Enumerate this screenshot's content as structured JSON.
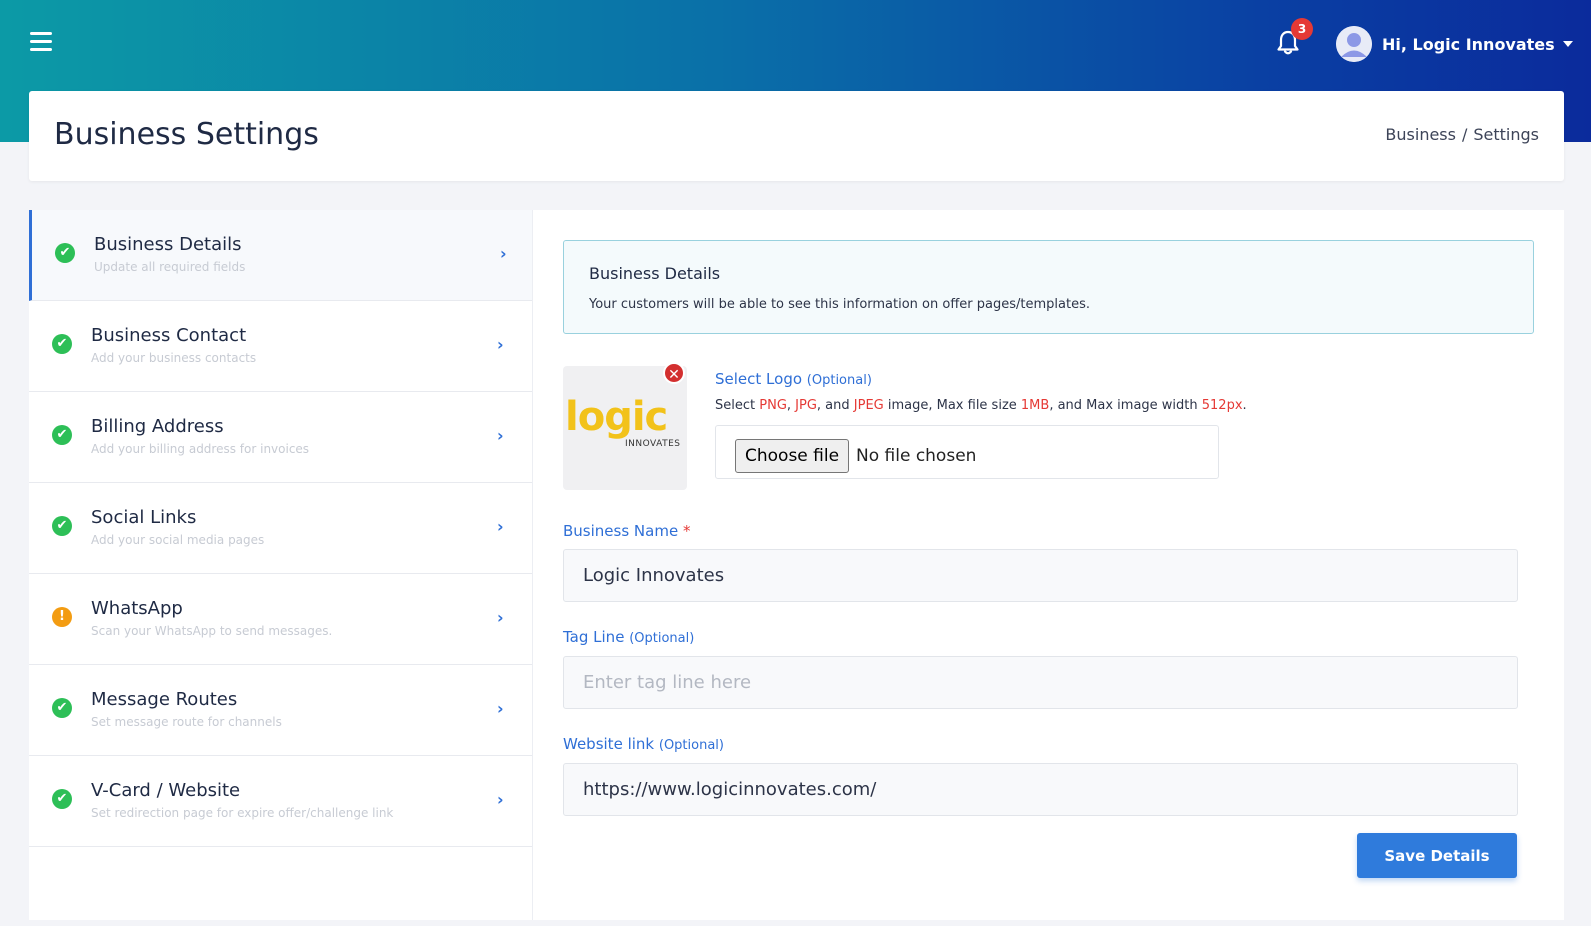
{
  "topbar": {
    "notification_count": "3",
    "user_greeting": "Hi, Logic Innovates"
  },
  "header": {
    "title": "Business Settings",
    "breadcrumb": [
      "Business",
      "Settings"
    ],
    "breadcrumb_sep": "/"
  },
  "sidebar": {
    "items": [
      {
        "title": "Business Details",
        "subtitle": "Update all required fields",
        "status": "ok",
        "status_glyph": "✔",
        "chevron": "›"
      },
      {
        "title": "Business Contact",
        "subtitle": "Add your business contacts",
        "status": "ok",
        "status_glyph": "✔",
        "chevron": "›"
      },
      {
        "title": "Billing Address",
        "subtitle": "Add your billing address for invoices",
        "status": "ok",
        "status_glyph": "✔",
        "chevron": "›"
      },
      {
        "title": "Social Links",
        "subtitle": "Add your social media pages",
        "status": "ok",
        "status_glyph": "✔",
        "chevron": "›"
      },
      {
        "title": "WhatsApp",
        "subtitle": "Scan your WhatsApp to send messages.",
        "status": "warn",
        "status_glyph": "!",
        "chevron": "›"
      },
      {
        "title": "Message Routes",
        "subtitle": "Set message route for channels",
        "status": "ok",
        "status_glyph": "✔",
        "chevron": "›"
      },
      {
        "title": "V-Card / Website",
        "subtitle": "Set redirection page for expire offer/challenge link",
        "status": "ok",
        "status_glyph": "✔",
        "chevron": "›"
      }
    ]
  },
  "main": {
    "info_title": "Business Details",
    "info_text": "Your customers will be able to see this information on offer pages/templates.",
    "logo": {
      "label": "Select Logo",
      "optional": "(Optional)",
      "hint_parts": [
        "Select ",
        "PNG",
        ", ",
        "JPG",
        ", and ",
        "JPEG",
        " image, Max file size ",
        "1MB",
        ", and Max image width ",
        "512px",
        "."
      ],
      "choose_button": "Choose file",
      "file_status": "No file chosen",
      "preview_word": "logic",
      "preview_sub": "INNOVATES",
      "remove_glyph": "✕"
    },
    "business_name": {
      "label": "Business Name",
      "required_mark": "*",
      "value": "Logic Innovates"
    },
    "tag_line": {
      "label": "Tag Line",
      "optional": "(Optional)",
      "placeholder": "Enter tag line here",
      "value": ""
    },
    "website": {
      "label": "Website link",
      "optional": "(Optional)",
      "value": "https://www.logicinnovates.com/"
    },
    "save_button": "Save Details"
  },
  "colors": {
    "accent": "#2f6fd6",
    "ok": "#2dbf57",
    "warn": "#f39c12",
    "danger": "#e53935"
  }
}
